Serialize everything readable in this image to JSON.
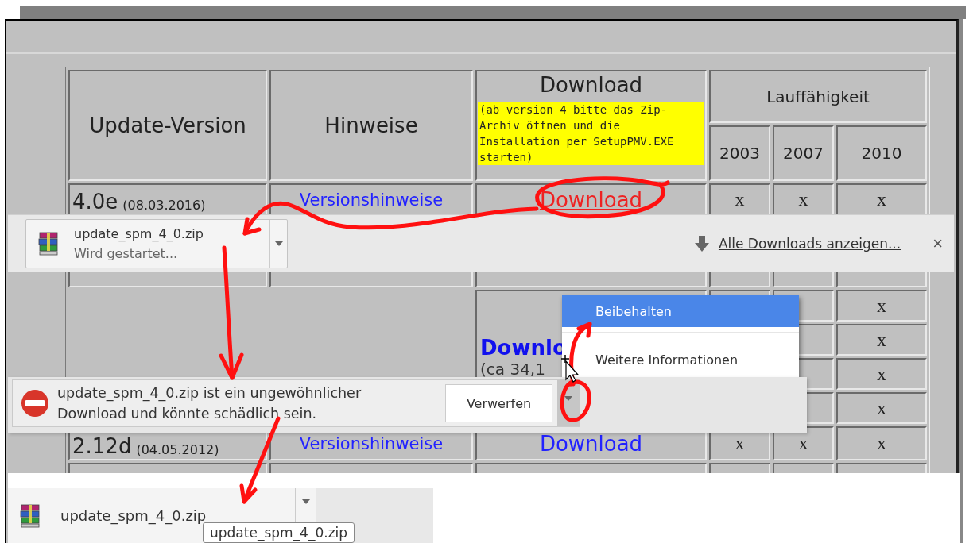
{
  "table": {
    "header": {
      "version": "Update-Version",
      "notes": "Hinweise",
      "download": "Download",
      "download_note": "(ab version 4 bitte das Zip-Archiv öffnen und die Installation per SetupPMV.EXE starten)",
      "compat": "Lauffähigkeit",
      "years": [
        "2003",
        "2007",
        "2010"
      ]
    },
    "rows": [
      {
        "kind": "full",
        "version": "4.0e",
        "date": "(08.03.2016)",
        "notes_link": "Versionshinweise",
        "download_link": "Download",
        "download_highlighted": true,
        "compat": [
          "x",
          "x",
          "x"
        ]
      },
      {
        "kind": "covered"
      },
      {
        "kind": "group",
        "download_link": "Downlo",
        "size": "(ca 34,1",
        "compat_last": [
          "x",
          "x",
          "x",
          "x"
        ]
      },
      {
        "kind": "full",
        "version": "2.12d",
        "date": "(04.05.2012)",
        "notes_link": "Versionshinweise",
        "download_link": "Download",
        "download_highlighted": false,
        "compat": [
          "x",
          "x",
          "x"
        ]
      },
      {
        "kind": "covered"
      }
    ]
  },
  "download_shelf": {
    "filename": "update_spm_4_0.zip",
    "status": "Wird gestartet...",
    "show_all_link": "Alle Downloads anzeigen...",
    "close": "×"
  },
  "context_menu": [
    {
      "label": "Beibehalten",
      "selected": true
    },
    {
      "label": "Weitere Informationen",
      "selected": false
    }
  ],
  "warning": {
    "message": "update_spm_4_0.zip ist ein ungewöhnlicher Download und könnte schädlich sein.",
    "button": "Verwerfen"
  },
  "bottom_item": {
    "filename": "update_spm_4_0.zip",
    "tooltip": "update_spm_4_0.zip"
  }
}
